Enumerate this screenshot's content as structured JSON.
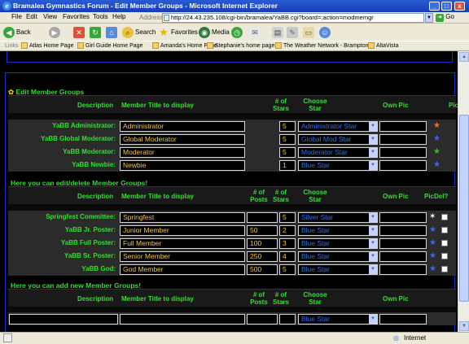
{
  "window": {
    "title": "Bramalea Gymnastics Forum - Edit Member Groups - Microsoft Internet Explorer",
    "btn_min": "_",
    "btn_max": "□",
    "btn_close": "x"
  },
  "menu": [
    "File",
    "Edit",
    "View",
    "Favorites",
    "Tools",
    "Help"
  ],
  "address": {
    "label": "Address",
    "url": "http://24.43.235.108/cgi-bin/bramalea/YaBB.cgi?board=;action=modmemgr",
    "go": "Go"
  },
  "toolbar": {
    "back": "Back",
    "search": "Search",
    "favorites": "Favorites",
    "media": "Media"
  },
  "links": {
    "label": "Links",
    "items": [
      "Atlas Home Page",
      "Girl Guide Home Page",
      "Amanda's Home Page",
      "Stephanie's home page",
      "The Weather Network - Brampton",
      "AltaVista"
    ]
  },
  "forum": {
    "section_title": "Edit Member Groups",
    "headers": {
      "description": "Description",
      "member_title": "Member Title to display",
      "posts": "# of Posts",
      "stars": "# of Stars",
      "choose_star": "Choose Star",
      "own_pic": "Own Pic",
      "pic": "Pic",
      "picdel": "PicDel?"
    },
    "fixed_groups": [
      {
        "desc": "YaBB Administrator:",
        "title": "Administrator",
        "stars": "5",
        "star": "Administrator Star",
        "color": "#e07a2c",
        "glyph": "★"
      },
      {
        "desc": "YaBB Global Moderator:",
        "title": "Global Moderator",
        "stars": "5",
        "star": "Global Mod Star",
        "color": "#4a5cf0",
        "glyph": "★"
      },
      {
        "desc": "YaBB Moderator:",
        "title": "Moderator",
        "stars": "5",
        "star": "Moderator Star",
        "color": "#3ab53a",
        "glyph": "★"
      },
      {
        "desc": "YaBB Newbie:",
        "title": "Newbie",
        "stars": "1",
        "star": "Blue Star",
        "color": "#3a6ae8",
        "glyph": "★"
      }
    ],
    "edit_title": "Here you can edit/delete Member Groups!",
    "edit_groups": [
      {
        "desc": "Springfest Committee:",
        "title": "Springfest",
        "posts": "",
        "stars": "5",
        "star": "Silver Star",
        "color": "#ffffff",
        "glyph": "✶"
      },
      {
        "desc": "YaBB Jr. Poster:",
        "title": "Junior Member",
        "posts": "50",
        "stars": "2",
        "star": "Blue Star",
        "color": "#3a6ae8",
        "glyph": "★"
      },
      {
        "desc": "YaBB Full Poster:",
        "title": "Full Member",
        "posts": "100",
        "stars": "3",
        "star": "Blue Star",
        "color": "#3a6ae8",
        "glyph": "★"
      },
      {
        "desc": "YaBB Sr. Poster:",
        "title": "Senior Member",
        "posts": "250",
        "stars": "4",
        "star": "Blue Star",
        "color": "#3a6ae8",
        "glyph": "★"
      },
      {
        "desc": "YaBB God:",
        "title": "God Member",
        "posts": "500",
        "stars": "5",
        "star": "Blue Star",
        "color": "#3a6ae8",
        "glyph": "★"
      }
    ],
    "add_title": "Here you can add new Member Groups!",
    "new_group": {
      "star": "Blue Star"
    }
  },
  "status": {
    "zone": "Internet"
  }
}
